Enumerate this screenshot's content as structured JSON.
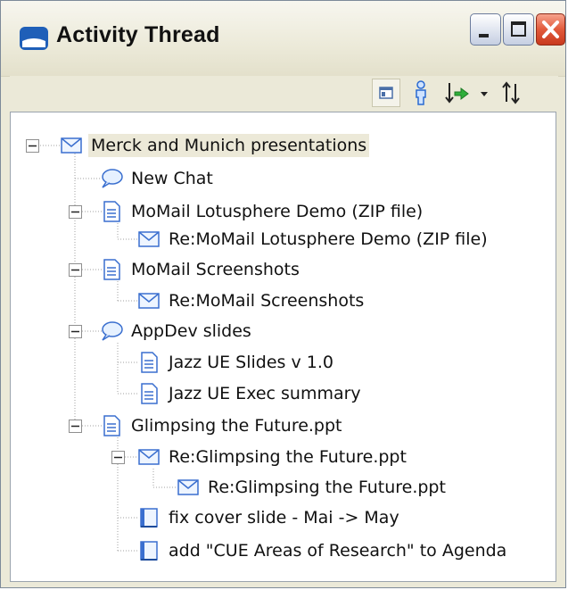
{
  "window": {
    "title": "Activity Thread",
    "buttons": {
      "minimize": "minimize",
      "maximize": "maximize",
      "close": "close"
    }
  },
  "toolbar": {
    "icons": [
      "layout-icon",
      "person-icon",
      "sort-icon",
      "dropdown-arrow-icon",
      "sort-order-icon"
    ]
  },
  "tree": {
    "items": [
      {
        "label": "Merck and Munich presentations",
        "icon": "email-icon",
        "selected": true
      },
      {
        "label": "New Chat",
        "icon": "chat-icon"
      },
      {
        "label": "MoMail Lotusphere Demo (ZIP file)",
        "icon": "document-icon"
      },
      {
        "label": "Re:MoMail Lotusphere Demo (ZIP file)",
        "icon": "email-icon"
      },
      {
        "label": "MoMail Screenshots",
        "icon": "document-icon"
      },
      {
        "label": "Re:MoMail Screenshots",
        "icon": "email-icon"
      },
      {
        "label": "AppDev slides",
        "icon": "chat-icon"
      },
      {
        "label": "Jazz UE Slides v 1.0",
        "icon": "document-icon"
      },
      {
        "label": "Jazz UE Exec summary",
        "icon": "document-icon"
      },
      {
        "label": "Glimpsing the Future.ppt",
        "icon": "document-icon"
      },
      {
        "label": "Re:Glimpsing the Future.ppt",
        "icon": "email-icon"
      },
      {
        "label": "Re:Glimpsing the Future.ppt",
        "icon": "email-icon"
      },
      {
        "label": "fix cover slide - Mai -> May",
        "icon": "task-icon"
      },
      {
        "label": "add \"CUE Areas of Research\" to Agenda",
        "icon": "task-icon"
      }
    ]
  },
  "colors": {
    "accent_blue": "#3a6fcf",
    "close_red": "#e25a3b",
    "chrome": "#ebe9d8",
    "selected_row": "#ece9d8"
  }
}
